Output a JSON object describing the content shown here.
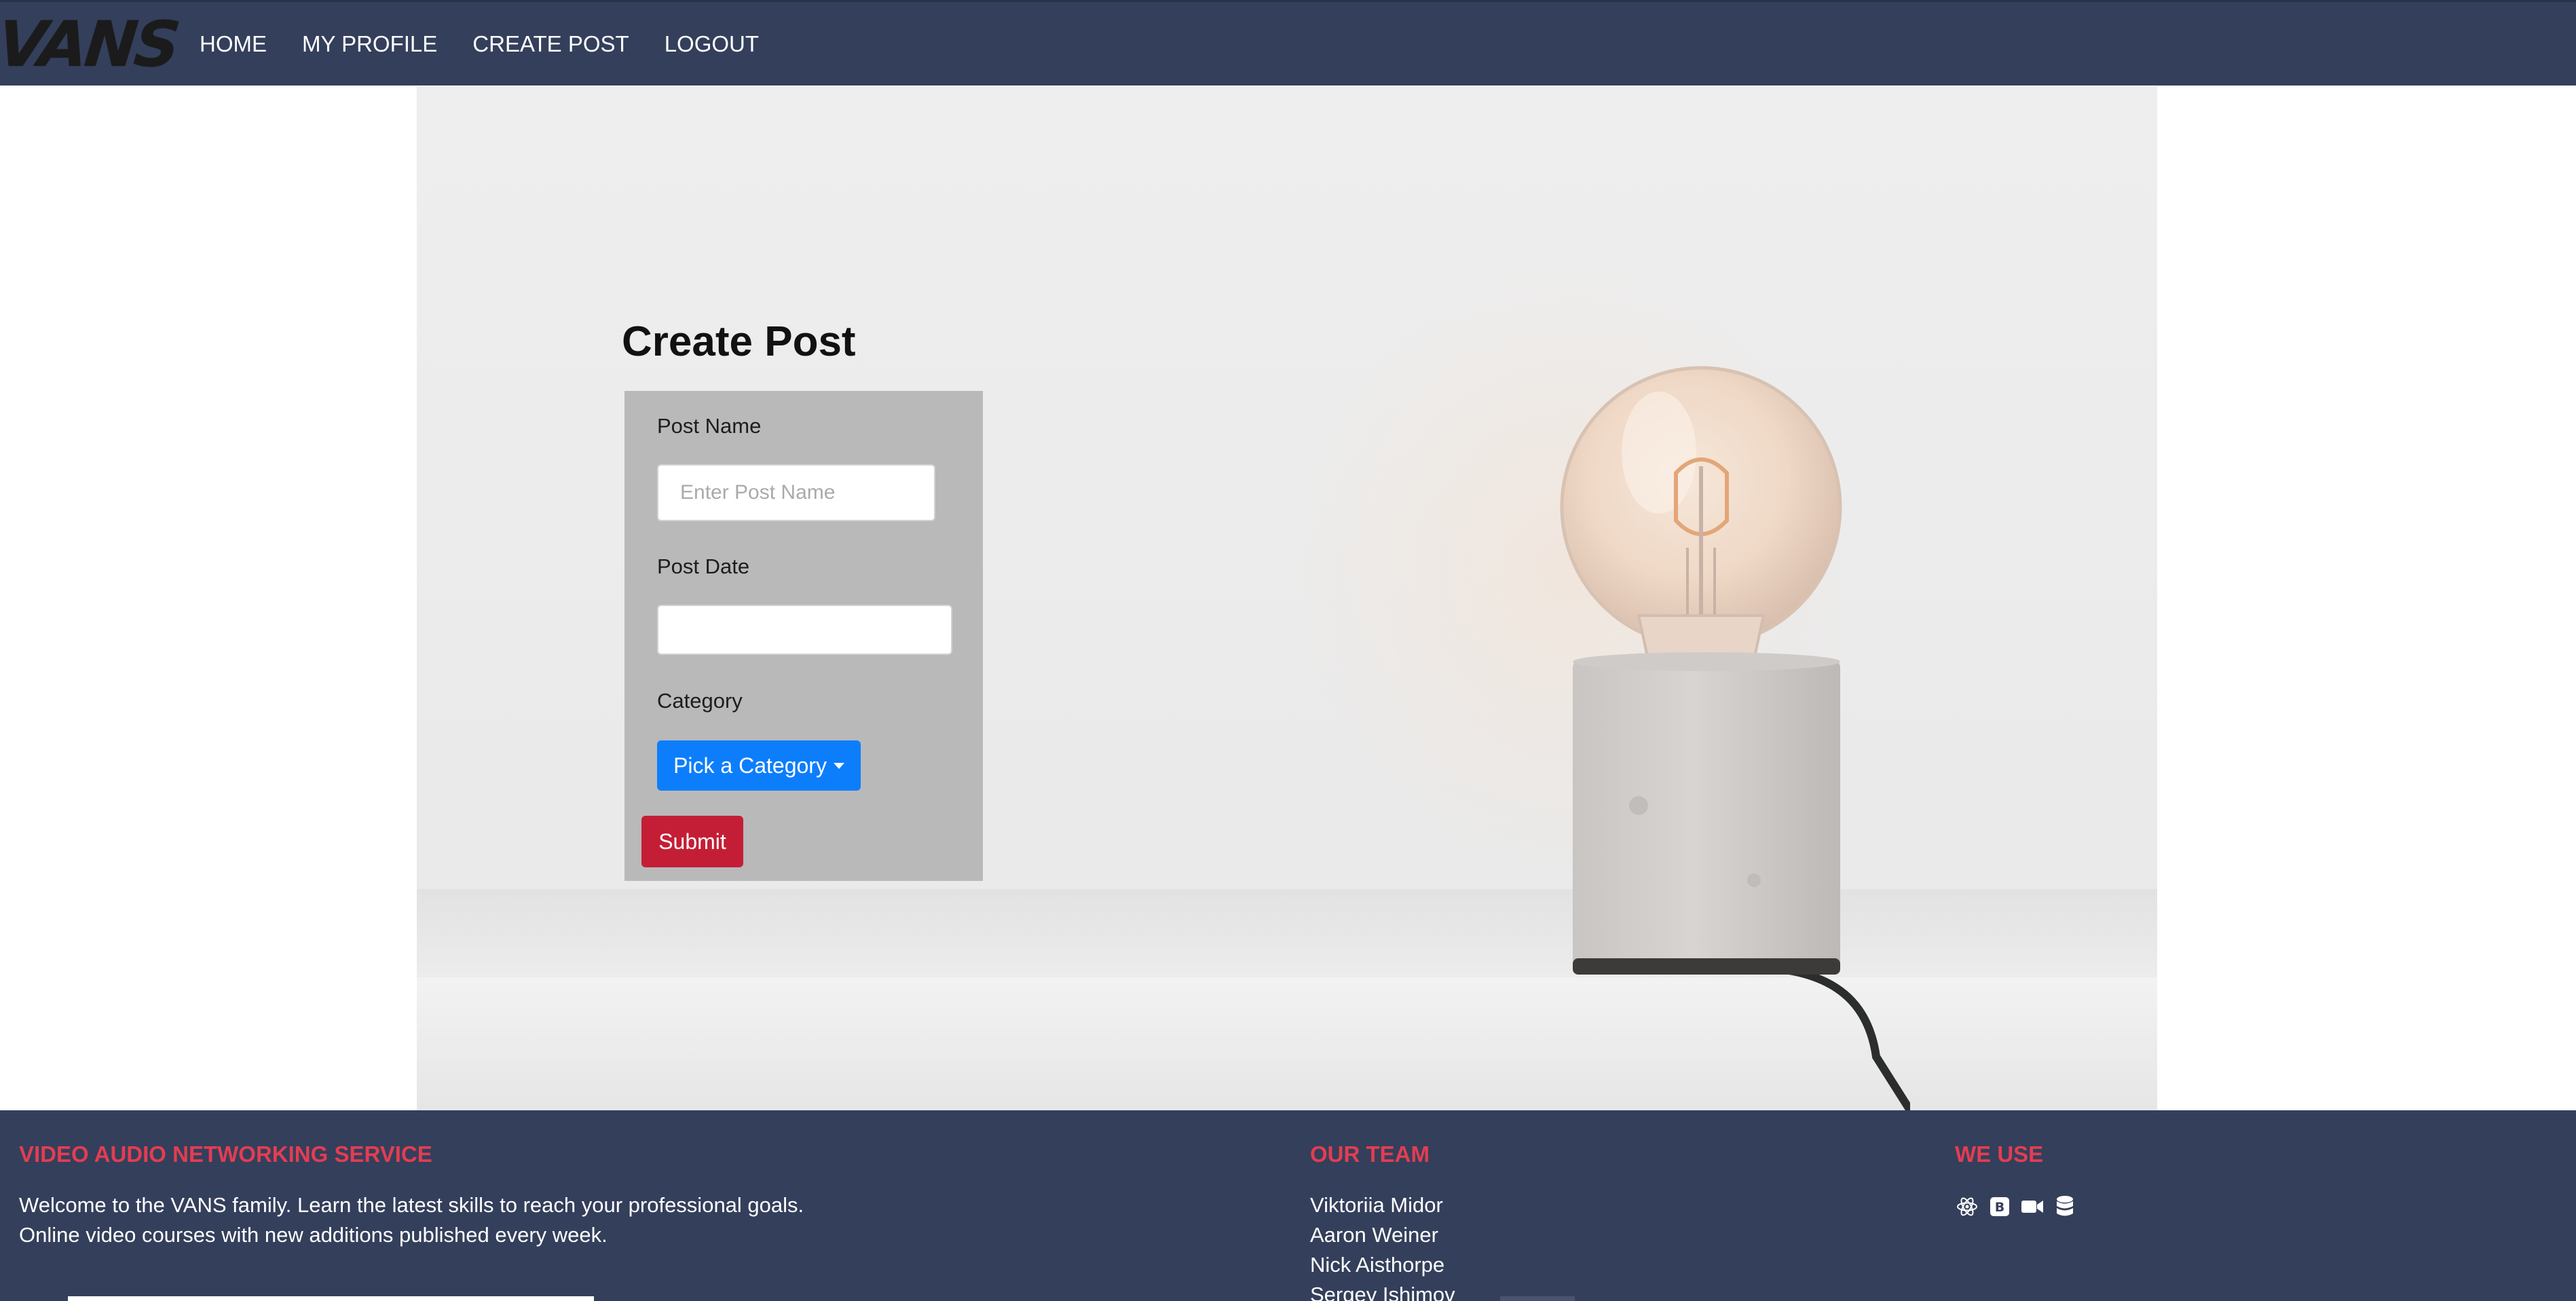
{
  "navbar": {
    "brand": "VANS",
    "links": [
      {
        "label": "HOME"
      },
      {
        "label": "MY PROFILE"
      },
      {
        "label": "CREATE POST"
      },
      {
        "label": "LOGOUT"
      }
    ]
  },
  "form": {
    "title": "Create Post",
    "post_name_label": "Post Name",
    "post_name_placeholder": "Enter Post Name",
    "post_name_value": "",
    "post_date_label": "Post Date",
    "post_date_value": "",
    "category_label": "Category",
    "category_button": "Pick a Category",
    "submit_label": "Submit"
  },
  "footer": {
    "about_heading": "VIDEO AUDIO NETWORKING SERVICE",
    "about_line1": "Welcome to the VANS family. Learn the latest skills to reach your professional goals.",
    "about_line2": "Online video courses with new additions published every week.",
    "team_heading": "OUR TEAM",
    "team": [
      "Viktoriia Midor",
      "Aaron Weiner",
      "Nick Aisthorpe",
      "Sergey Ishimov"
    ],
    "tech_heading": "WE USE",
    "tech_icons": [
      "react-icon",
      "bootstrap-icon",
      "video-camera-icon",
      "database-icon"
    ]
  },
  "colors": {
    "navbar_bg": "#343f5b",
    "footer_heading": "#e23d52",
    "dropdown_bg": "#0d7efb",
    "submit_bg": "#c41e36",
    "form_card_bg": "#b9b9b9"
  }
}
